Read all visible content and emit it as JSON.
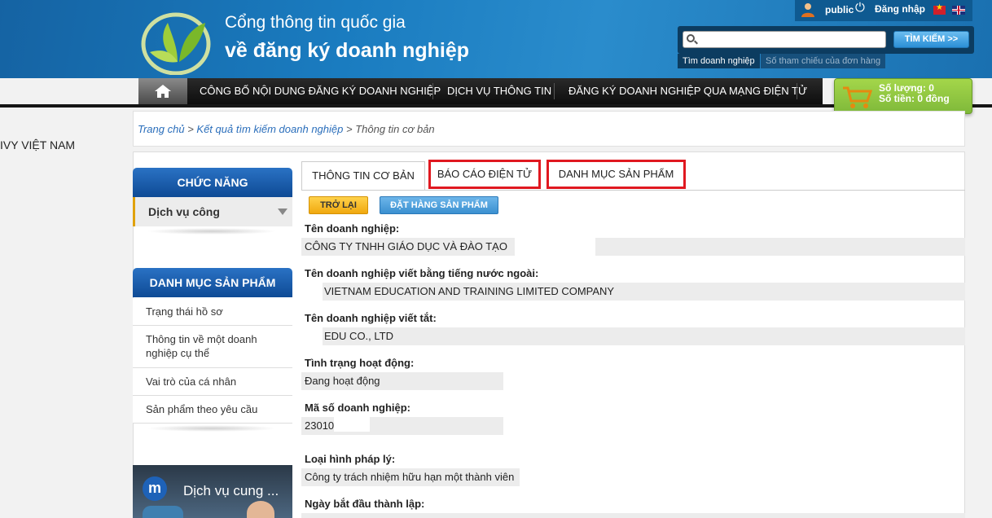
{
  "header": {
    "title_line1": "Cổng thông tin quốc gia",
    "title_line2": "về đăng ký doanh nghiệp",
    "user_name": "public",
    "login_label": "Đăng nhập",
    "search": {
      "placeholder": "",
      "button": "TÌM KIẾM >>"
    },
    "search_tabs": [
      "Tìm doanh nghiệp",
      "Số tham chiếu của đơn hàng"
    ]
  },
  "nav": {
    "items": [
      "CÔNG BỐ NỘI DUNG ĐĂNG KÝ DOANH NGHIỆP",
      "DỊCH VỤ THÔNG TIN",
      "ĐĂNG KÝ DOANH NGHIỆP QUA MẠNG ĐIỆN TỬ"
    ]
  },
  "cart": {
    "quantity": "Số lượng: 0",
    "amount": "Số tiền: 0 đồng"
  },
  "left_stray_text": "IVY VIỆT NAM",
  "breadcrumb": {
    "home": "Trang chủ",
    "sep": " > ",
    "results": "Kết quả tìm kiếm doanh nghiệp",
    "current": "Thông tin cơ bản"
  },
  "sidebar": {
    "functions_header": "CHỨC NĂNG",
    "functions_item": "Dịch vụ công",
    "catalog_header": "DANH MỤC SẢN PHẨM",
    "catalog_items": [
      "Trạng thái hồ sơ",
      "Thông tin về một doanh nghiệp cụ thể",
      "Vai trò của cá nhân",
      "Sản phẩm theo yêu cầu"
    ],
    "video_title": "Dịch vụ cung ..."
  },
  "tabs": [
    "THÔNG TIN CƠ BẢN",
    "BÁO CÁO ĐIỆN TỬ",
    "DANH MỤC SẢN PHẨM"
  ],
  "buttons": {
    "back": "TRỞ LẠI",
    "order": "ĐẶT HÀNG SẢN PHẨM"
  },
  "fields": [
    {
      "label": "Tên doanh nghiệp:",
      "value": "CÔNG TY TNHH GIÁO DỤC VÀ ĐÀO TẠO"
    },
    {
      "label": "Tên doanh nghiệp viết bằng tiếng nước ngoài:",
      "value": "VIETNAM EDUCATION AND TRAINING LIMITED COMPANY"
    },
    {
      "label": "Tên doanh nghiệp viết tắt:",
      "value": "EDU CO., LTD"
    },
    {
      "label": "Tình trạng hoạt động:",
      "value": "Đang hoạt động"
    },
    {
      "label": "Mã số doanh nghiệp:",
      "value": "23010"
    },
    {
      "label": "Loại hình pháp lý:",
      "value": "Công ty trách nhiệm hữu hạn một thành viên"
    },
    {
      "label": "Ngày bắt đầu thành lập:",
      "value": ""
    }
  ],
  "colors": {
    "header_blue": "#1a78b8",
    "sidebar_header": "#0e4a95",
    "back_button": "#f0a80e",
    "order_button": "#3a8fd0",
    "highlight_box": "#e01820",
    "cart_green": "#8cc63f"
  },
  "icons": [
    "home-icon",
    "search-icon",
    "user-icon",
    "power-icon",
    "cart-icon",
    "chevron-down-icon"
  ]
}
